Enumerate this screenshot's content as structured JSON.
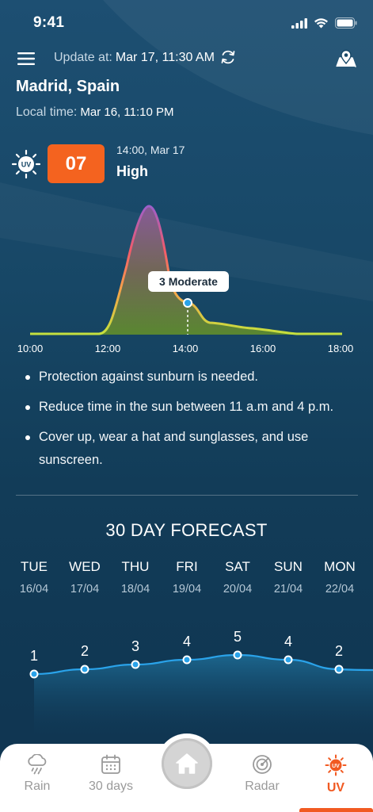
{
  "status_bar": {
    "time": "9:41"
  },
  "header": {
    "update_label": "Update at:",
    "update_value": "Mar 17, 11:30 AM",
    "location": "Madrid, Spain",
    "local_time_label": "Local time:",
    "local_time_value": "Mar 16, 11:10 PM"
  },
  "uv_now": {
    "icon": "uv-sun-icon",
    "index": "07",
    "time": "14:00, Mar 17",
    "level": "High",
    "badge_color": "#f4631f"
  },
  "chart_data": [
    {
      "type": "area",
      "x": [
        "10:00",
        "12:00",
        "14:00",
        "16:00",
        "18:00"
      ],
      "series": [
        {
          "values": [
            0,
            0.5,
            7,
            1.2,
            0
          ]
        }
      ],
      "tooltip": {
        "text": "3 Moderate",
        "x": "14:00",
        "value": 3
      },
      "colors": [
        "#c5e03e",
        "#f6a14a",
        "#f25b6a",
        "#9d5fc9"
      ]
    },
    {
      "type": "line",
      "categories": [
        "TUE",
        "WED",
        "THU",
        "FRI",
        "SAT",
        "SUN",
        "MON"
      ],
      "series": [
        {
          "values": [
            1,
            2,
            3,
            4,
            5,
            4,
            2
          ]
        }
      ],
      "color": "#2aa3ea"
    }
  ],
  "advice": [
    "Protection against sunburn is needed.",
    "Reduce time in the sun between 11 a.m and 4 p.m.",
    "Cover up, wear a hat and sunglasses, and use sunscreen."
  ],
  "forecast": {
    "title": "30 DAY FORECAST",
    "days": [
      {
        "name": "TUE",
        "date": "16/04",
        "uv": "1"
      },
      {
        "name": "WED",
        "date": "17/04",
        "uv": "2"
      },
      {
        "name": "THU",
        "date": "18/04",
        "uv": "3"
      },
      {
        "name": "FRI",
        "date": "19/04",
        "uv": "4"
      },
      {
        "name": "SAT",
        "date": "20/04",
        "uv": "5"
      },
      {
        "name": "SUN",
        "date": "21/04",
        "uv": "4"
      },
      {
        "name": "MON",
        "date": "22/04",
        "uv": "2"
      }
    ]
  },
  "nav": {
    "items": [
      {
        "label": "Rain",
        "icon": "rain-cloud-icon"
      },
      {
        "label": "30 days",
        "icon": "calendar-icon"
      },
      {
        "label": "",
        "icon": "home-icon"
      },
      {
        "label": "Radar",
        "icon": "radar-icon"
      },
      {
        "label": "UV",
        "icon": "uv-sun-icon"
      }
    ],
    "active": "UV",
    "accent": "#f15a22"
  }
}
